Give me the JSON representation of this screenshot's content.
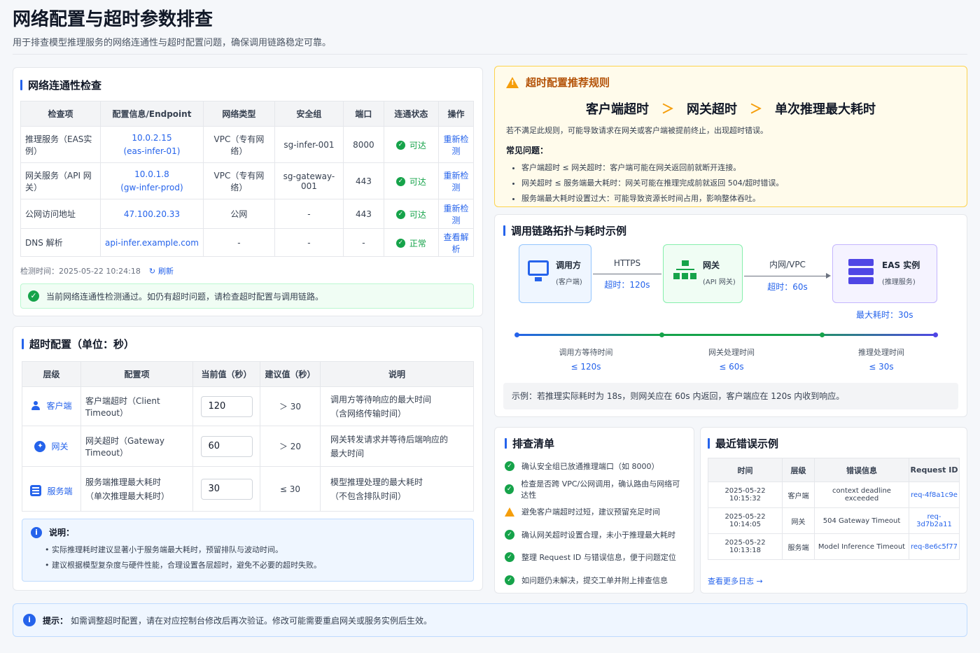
{
  "header": {
    "title": "网络配置与超时参数排查",
    "subtitle": "用于排查模型推理服务的网络连通性与超时配置问题，确保调用链路稳定可靠。"
  },
  "connectivity": {
    "title": "网络连通性检查",
    "columns": [
      "检查项",
      "配置信息/Endpoint",
      "网络类型",
      "安全组",
      "端口",
      "连通状态",
      "操作"
    ],
    "rows": [
      {
        "item": "推理服务（EAS实例）",
        "endpoint1": "10.0.2.15",
        "endpoint2": "(eas-infer-01)",
        "net": "VPC（专有网络）",
        "sg": "sg-infer-001",
        "port": "8000",
        "status": "可达",
        "action": "重新检测"
      },
      {
        "item": "网关服务（API 网关）",
        "endpoint1": "10.0.1.8",
        "endpoint2": "(gw-infer-prod)",
        "net": "VPC（专有网络）",
        "sg": "sg-gateway-001",
        "port": "443",
        "status": "可达",
        "action": "重新检测"
      },
      {
        "item": "公网访问地址",
        "endpoint1": "47.100.20.33",
        "endpoint2": "",
        "net": "公网",
        "sg": "-",
        "port": "443",
        "status": "可达",
        "action": "重新检测"
      },
      {
        "item": "DNS 解析",
        "endpoint1": "api-infer.example.com",
        "endpoint2": "",
        "net": "-",
        "sg": "-",
        "port": "-",
        "status": "正常",
        "action": "查看解析"
      }
    ],
    "check_time": "检测时间：2025-05-22 10:24:18",
    "refresh": "刷新",
    "success_msg": "当前网络连通性检测通过。如仍有超时问题，请检查超时配置与调用链路。"
  },
  "timeout": {
    "title": "超时配置（单位：秒）",
    "columns": [
      "层级",
      "配置项",
      "当前值（秒）",
      "建议值（秒）",
      "说明"
    ],
    "rows": [
      {
        "layer": "客户端",
        "item1": "客户端超时（Client Timeout）",
        "item2": "",
        "value": "120",
        "suggest": "＞ 30",
        "desc1": "调用方等待响应的最大时间",
        "desc2": "（含网络传输时间）"
      },
      {
        "layer": "网关",
        "item1": "网关超时（Gateway Timeout）",
        "item2": "",
        "value": "60",
        "suggest": "＞ 20",
        "desc1": "网关转发请求并等待后端响应的",
        "desc2": "最大时间"
      },
      {
        "layer": "服务端",
        "item1": "服务端推理最大耗时",
        "item2": "（单次推理最大耗时）",
        "value": "30",
        "suggest": "≤ 30",
        "desc1": "模型推理处理的最大耗时",
        "desc2": "（不包含排队时间）"
      }
    ],
    "note_title": "说明：",
    "notes": [
      "• 实际推理耗时建议显著小于服务端最大耗时，预留排队与波动时间。",
      "• 建议根据模型复杂度与硬件性能，合理设置各层超时，避免不必要的超时失败。"
    ]
  },
  "rules": {
    "title": "超时配置推荐规则",
    "chain": [
      "客户端超时",
      "＞",
      "网关超时",
      "＞",
      "单次推理最大耗时"
    ],
    "warning": "若不满足此规则，可能导致请求在网关或客户端被提前终止，出现超时错误。",
    "issues_title": "常见问题：",
    "issues": [
      "客户端超时 ≤ 网关超时：客户端可能在网关返回前就断开连接。",
      "网关超时 ≤ 服务端最大耗时：网关可能在推理完成前就返回 504/超时错误。",
      "服务端最大耗时设置过大：可能导致资源长时间占用，影响整体吞吐。"
    ]
  },
  "topology": {
    "title": "调用链路拓扑与耗时示例",
    "nodes": [
      {
        "name": "调用方",
        "sub": "(客户端)"
      },
      {
        "name": "网关",
        "sub": "(API 网关)"
      },
      {
        "name": "EAS 实例",
        "sub": "(推理服务)"
      }
    ],
    "links": [
      {
        "proto": "HTTPS",
        "timeout": "超时：120s"
      },
      {
        "proto": "内网/VPC",
        "timeout": "超时：60s"
      }
    ],
    "max_cost": "最大耗时：30s",
    "timeline": [
      {
        "label": "调用方等待时间",
        "value": "≤ 120s"
      },
      {
        "label": "网关处理时间",
        "value": "≤ 60s"
      },
      {
        "label": "推理处理时间",
        "value": "≤ 30s"
      }
    ],
    "example": "示例：若推理实际耗时为 18s，则网关应在 60s 内返回，客户端应在 120s 内收到响应。"
  },
  "checklist": {
    "title": "排查清单",
    "items": [
      {
        "text": "确认安全组已放通推理端口（如 8000）",
        "state": "ok"
      },
      {
        "text": "检查是否跨 VPC/公网调用，确认路由与网络可达性",
        "state": "ok"
      },
      {
        "text": "避免客户端超时过短，建议预留充足时间",
        "state": "warn"
      },
      {
        "text": "确认网关超时设置合理，未小于推理最大耗时",
        "state": "ok"
      },
      {
        "text": "整理 Request ID 与错误信息，便于问题定位",
        "state": "ok"
      },
      {
        "text": "如问题仍未解决，提交工单并附上排查信息",
        "state": "ok"
      }
    ]
  },
  "errors": {
    "title": "最近错误示例",
    "columns": [
      "时间",
      "层级",
      "错误信息",
      "Request ID"
    ],
    "rows": [
      {
        "time": "2025-05-22 10:15:32",
        "layer": "客户端",
        "msg": "context deadline exceeded",
        "rid": "req-4f8a1c9e"
      },
      {
        "time": "2025-05-22 10:14:05",
        "layer": "网关",
        "msg": "504 Gateway Timeout",
        "rid": "req-3d7b2a11"
      },
      {
        "time": "2025-05-22 10:13:18",
        "layer": "服务端",
        "msg": "Model Inference Timeout",
        "rid": "req-8e6c5f77"
      }
    ],
    "more": "查看更多日志 →"
  },
  "tip": {
    "label": "提示：",
    "text": "如需调整超时配置，请在对应控制台修改后再次验证。修改可能需要重启网关或服务实例后生效。"
  }
}
